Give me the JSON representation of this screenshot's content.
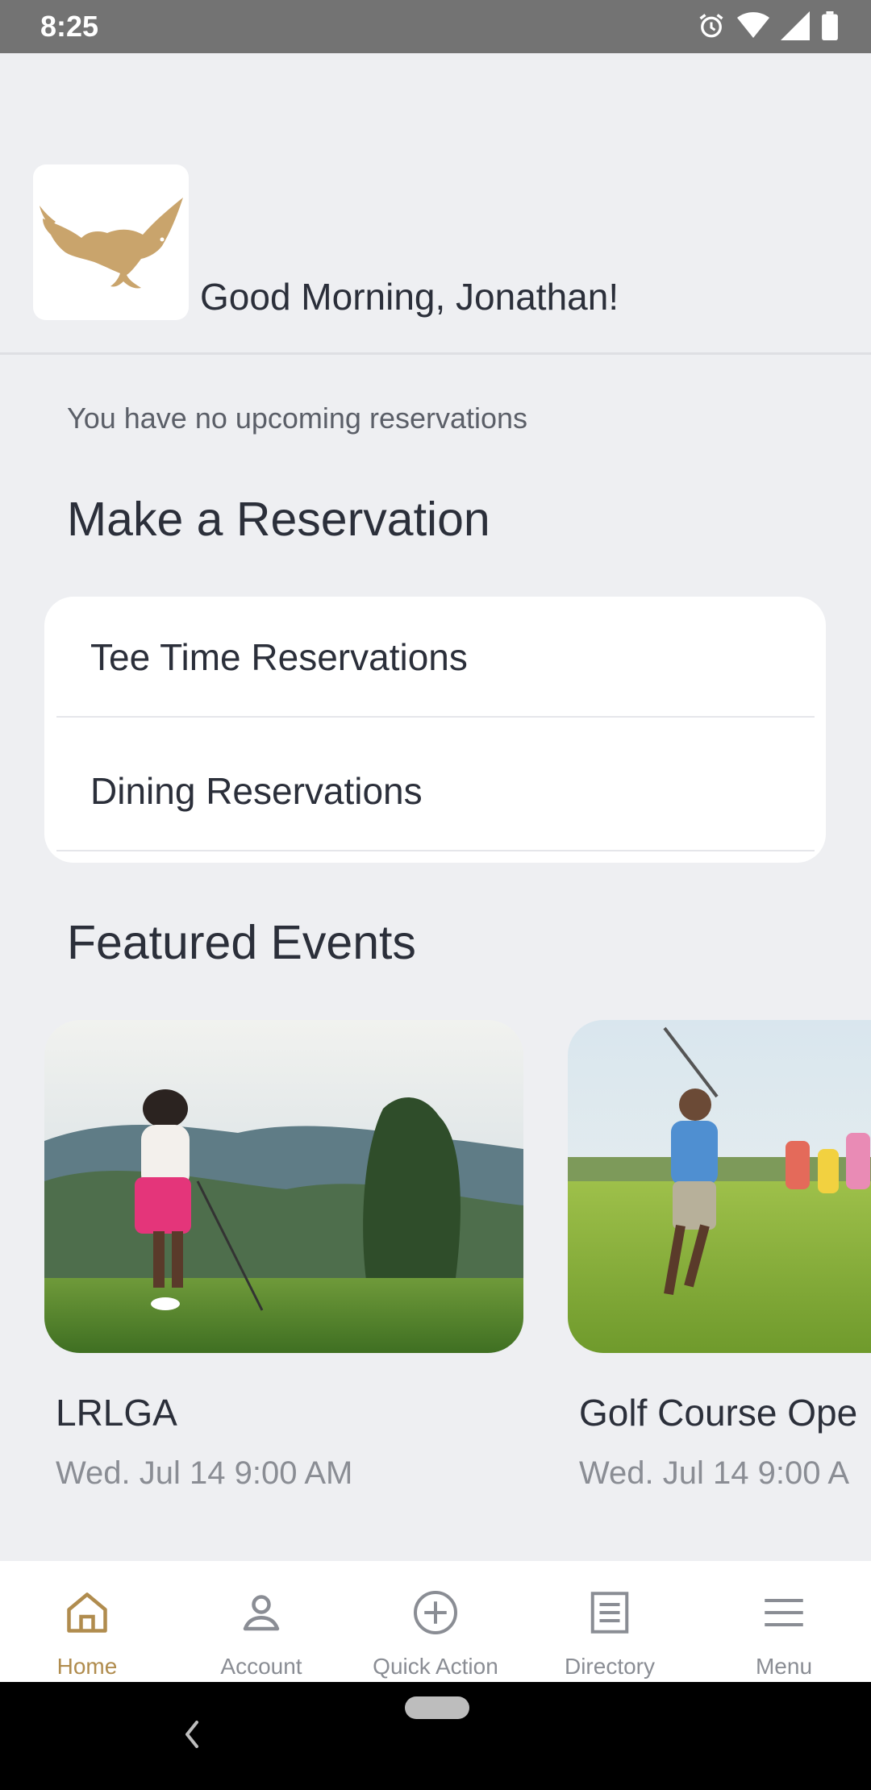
{
  "status_bar": {
    "time": "8:25"
  },
  "header": {
    "greeting": "Good Morning, Jonathan!"
  },
  "reservations": {
    "empty_message": "You have no upcoming reservations",
    "section_title": "Make a Reservation",
    "items": [
      {
        "label": "Tee Time Reservations"
      },
      {
        "label": "Dining Reservations"
      }
    ]
  },
  "featured": {
    "section_title": "Featured Events",
    "events": [
      {
        "title": "LRLGA",
        "date": "Wed. Jul 14 9:00 AM"
      },
      {
        "title": "Golf Course Ope",
        "date": "Wed. Jul 14 9:00 A"
      }
    ]
  },
  "bottom_nav": {
    "items": [
      {
        "label": "Home",
        "icon": "home-icon"
      },
      {
        "label": "Account",
        "icon": "person-icon"
      },
      {
        "label": "Quick Action",
        "icon": "plus-circle-icon"
      },
      {
        "label": "Directory",
        "icon": "list-icon"
      },
      {
        "label": "Menu",
        "icon": "hamburger-icon"
      }
    ]
  },
  "colors": {
    "accent": "#b08c4e",
    "background": "#eeeff2",
    "text": "#2b2f3a",
    "muted": "#8a8d94"
  }
}
